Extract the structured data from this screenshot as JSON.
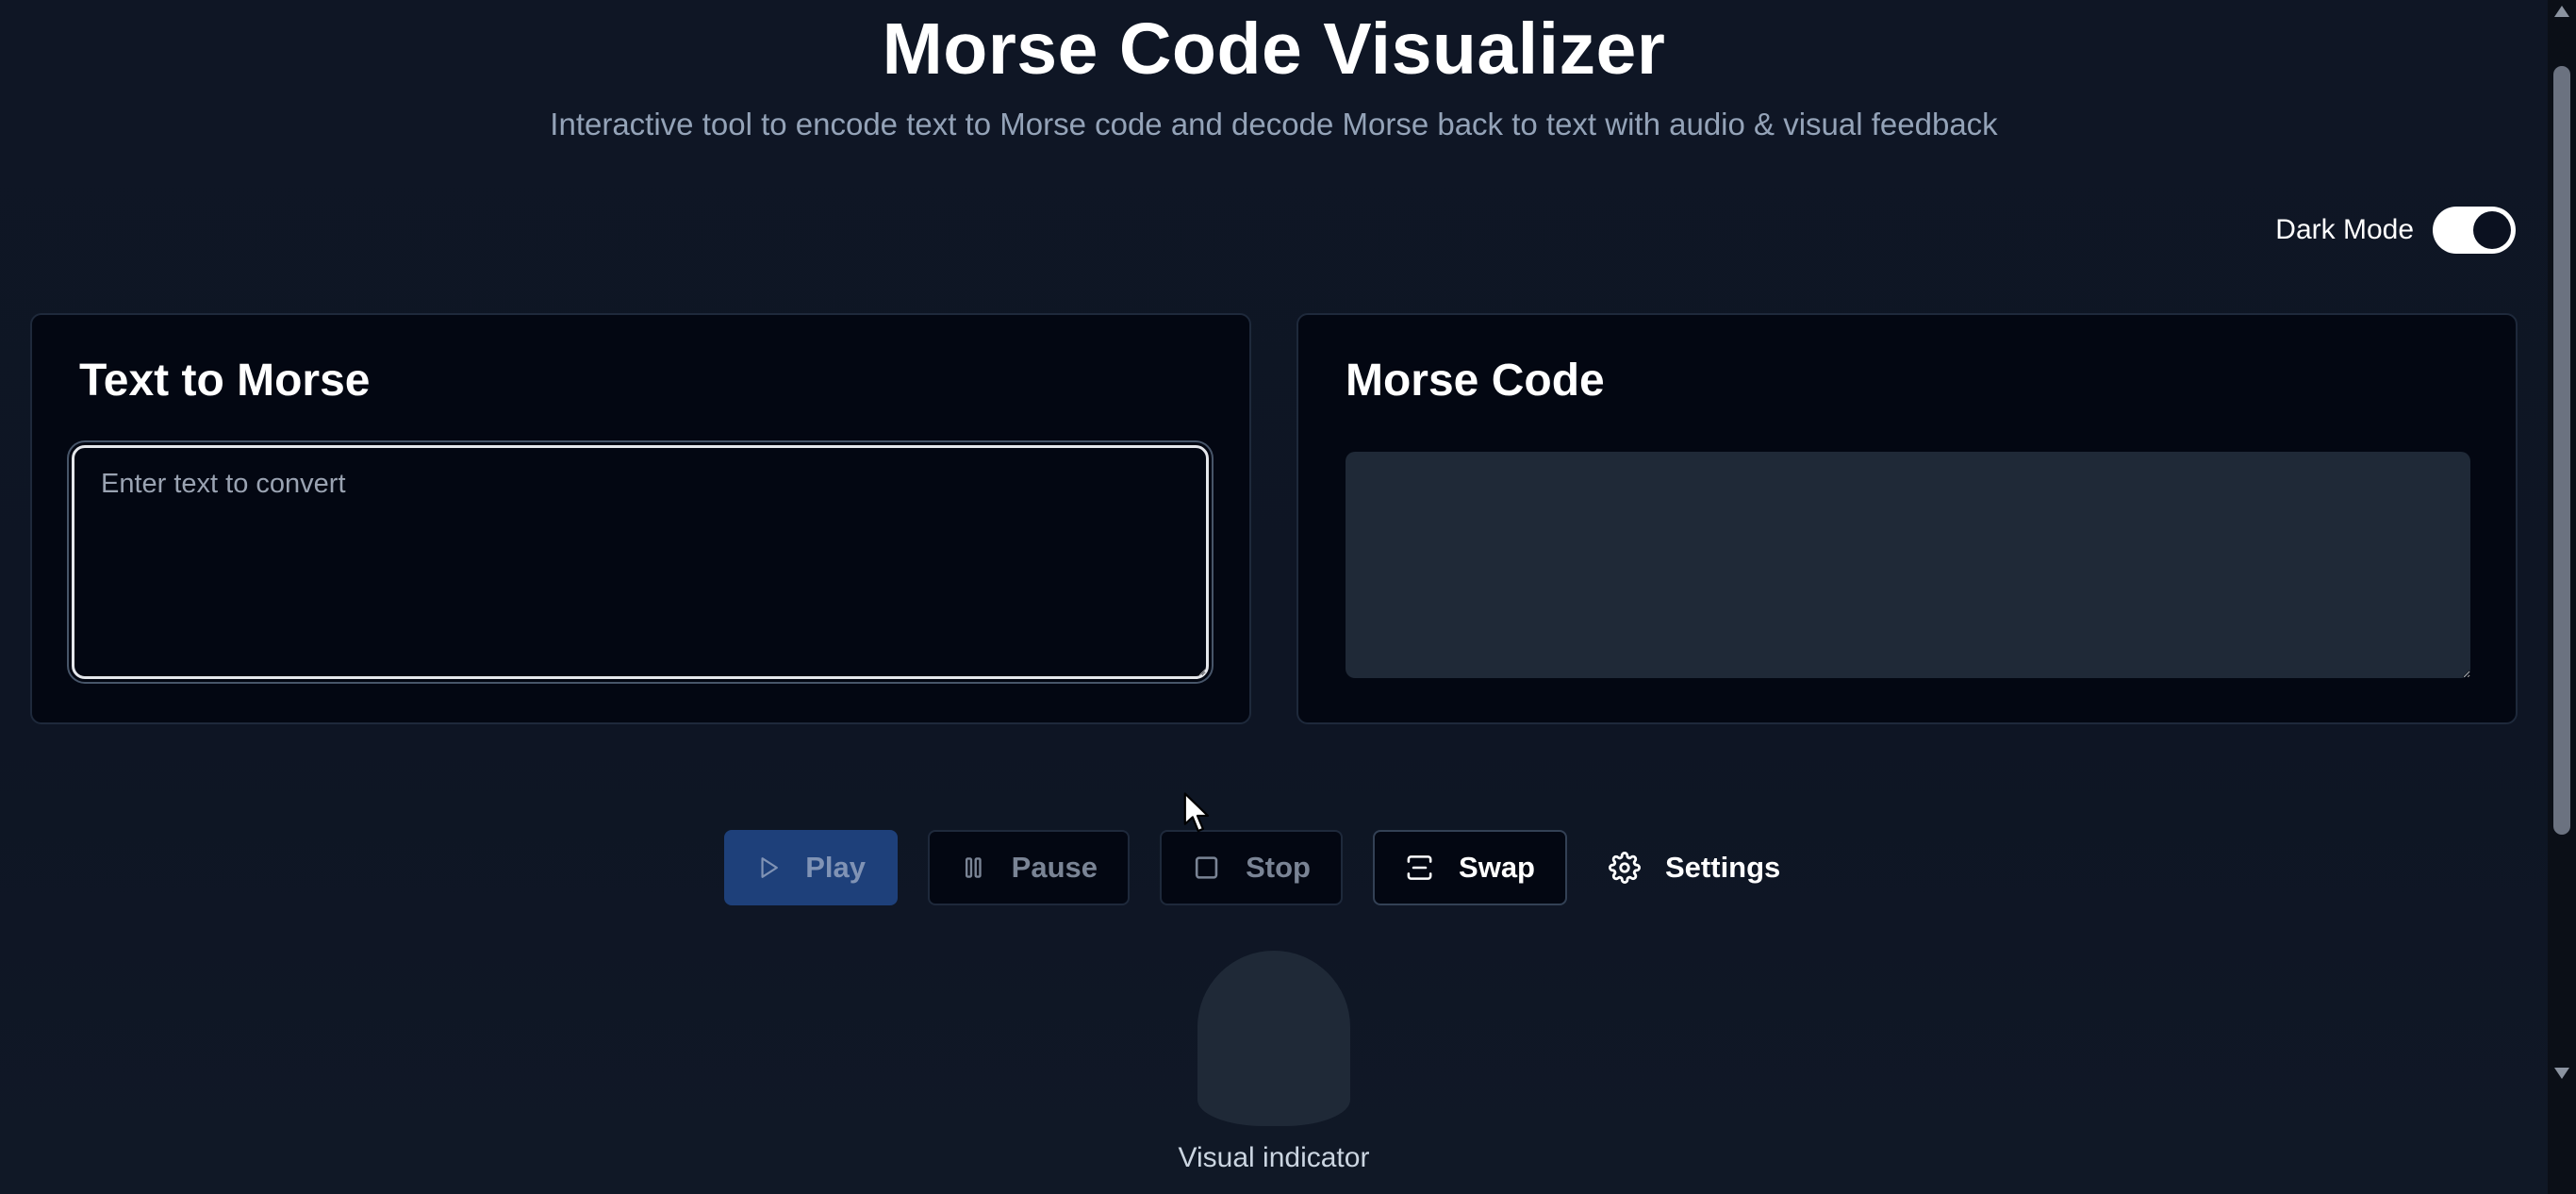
{
  "header": {
    "title": "Morse Code Visualizer",
    "subtitle": "Interactive tool to encode text to Morse code and decode Morse back to text with audio & visual feedback"
  },
  "theme": {
    "dark_mode_label": "Dark Mode",
    "dark_mode_on": true,
    "accent_color": "#1e407a"
  },
  "text_panel": {
    "title": "Text to Morse",
    "input_value": "",
    "input_placeholder": "Enter text to convert"
  },
  "morse_panel": {
    "title": "Morse Code",
    "output_value": ""
  },
  "controls": {
    "play_label": "Play",
    "pause_label": "Pause",
    "stop_label": "Stop",
    "swap_label": "Swap",
    "settings_label": "Settings",
    "icons": [
      "play-icon",
      "pause-icon",
      "stop-icon",
      "swap-icon",
      "gear-icon"
    ]
  },
  "indicator": {
    "label": "Visual indicator"
  }
}
